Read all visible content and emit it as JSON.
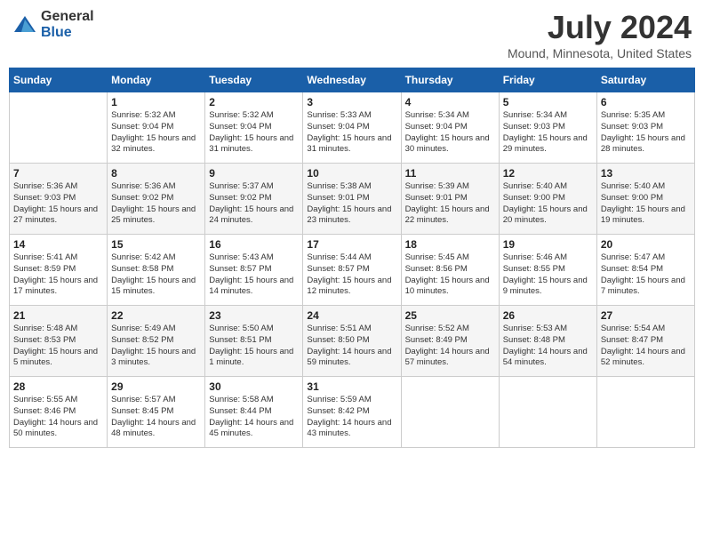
{
  "header": {
    "logo_general": "General",
    "logo_blue": "Blue",
    "month_title": "July 2024",
    "location": "Mound, Minnesota, United States"
  },
  "weekdays": [
    "Sunday",
    "Monday",
    "Tuesday",
    "Wednesday",
    "Thursday",
    "Friday",
    "Saturday"
  ],
  "weeks": [
    [
      {
        "day": "",
        "info": ""
      },
      {
        "day": "1",
        "info": "Sunrise: 5:32 AM\nSunset: 9:04 PM\nDaylight: 15 hours\nand 32 minutes."
      },
      {
        "day": "2",
        "info": "Sunrise: 5:32 AM\nSunset: 9:04 PM\nDaylight: 15 hours\nand 31 minutes."
      },
      {
        "day": "3",
        "info": "Sunrise: 5:33 AM\nSunset: 9:04 PM\nDaylight: 15 hours\nand 31 minutes."
      },
      {
        "day": "4",
        "info": "Sunrise: 5:34 AM\nSunset: 9:04 PM\nDaylight: 15 hours\nand 30 minutes."
      },
      {
        "day": "5",
        "info": "Sunrise: 5:34 AM\nSunset: 9:03 PM\nDaylight: 15 hours\nand 29 minutes."
      },
      {
        "day": "6",
        "info": "Sunrise: 5:35 AM\nSunset: 9:03 PM\nDaylight: 15 hours\nand 28 minutes."
      }
    ],
    [
      {
        "day": "7",
        "info": "Sunrise: 5:36 AM\nSunset: 9:03 PM\nDaylight: 15 hours\nand 27 minutes."
      },
      {
        "day": "8",
        "info": "Sunrise: 5:36 AM\nSunset: 9:02 PM\nDaylight: 15 hours\nand 25 minutes."
      },
      {
        "day": "9",
        "info": "Sunrise: 5:37 AM\nSunset: 9:02 PM\nDaylight: 15 hours\nand 24 minutes."
      },
      {
        "day": "10",
        "info": "Sunrise: 5:38 AM\nSunset: 9:01 PM\nDaylight: 15 hours\nand 23 minutes."
      },
      {
        "day": "11",
        "info": "Sunrise: 5:39 AM\nSunset: 9:01 PM\nDaylight: 15 hours\nand 22 minutes."
      },
      {
        "day": "12",
        "info": "Sunrise: 5:40 AM\nSunset: 9:00 PM\nDaylight: 15 hours\nand 20 minutes."
      },
      {
        "day": "13",
        "info": "Sunrise: 5:40 AM\nSunset: 9:00 PM\nDaylight: 15 hours\nand 19 minutes."
      }
    ],
    [
      {
        "day": "14",
        "info": "Sunrise: 5:41 AM\nSunset: 8:59 PM\nDaylight: 15 hours\nand 17 minutes."
      },
      {
        "day": "15",
        "info": "Sunrise: 5:42 AM\nSunset: 8:58 PM\nDaylight: 15 hours\nand 15 minutes."
      },
      {
        "day": "16",
        "info": "Sunrise: 5:43 AM\nSunset: 8:57 PM\nDaylight: 15 hours\nand 14 minutes."
      },
      {
        "day": "17",
        "info": "Sunrise: 5:44 AM\nSunset: 8:57 PM\nDaylight: 15 hours\nand 12 minutes."
      },
      {
        "day": "18",
        "info": "Sunrise: 5:45 AM\nSunset: 8:56 PM\nDaylight: 15 hours\nand 10 minutes."
      },
      {
        "day": "19",
        "info": "Sunrise: 5:46 AM\nSunset: 8:55 PM\nDaylight: 15 hours\nand 9 minutes."
      },
      {
        "day": "20",
        "info": "Sunrise: 5:47 AM\nSunset: 8:54 PM\nDaylight: 15 hours\nand 7 minutes."
      }
    ],
    [
      {
        "day": "21",
        "info": "Sunrise: 5:48 AM\nSunset: 8:53 PM\nDaylight: 15 hours\nand 5 minutes."
      },
      {
        "day": "22",
        "info": "Sunrise: 5:49 AM\nSunset: 8:52 PM\nDaylight: 15 hours\nand 3 minutes."
      },
      {
        "day": "23",
        "info": "Sunrise: 5:50 AM\nSunset: 8:51 PM\nDaylight: 15 hours\nand 1 minute."
      },
      {
        "day": "24",
        "info": "Sunrise: 5:51 AM\nSunset: 8:50 PM\nDaylight: 14 hours\nand 59 minutes."
      },
      {
        "day": "25",
        "info": "Sunrise: 5:52 AM\nSunset: 8:49 PM\nDaylight: 14 hours\nand 57 minutes."
      },
      {
        "day": "26",
        "info": "Sunrise: 5:53 AM\nSunset: 8:48 PM\nDaylight: 14 hours\nand 54 minutes."
      },
      {
        "day": "27",
        "info": "Sunrise: 5:54 AM\nSunset: 8:47 PM\nDaylight: 14 hours\nand 52 minutes."
      }
    ],
    [
      {
        "day": "28",
        "info": "Sunrise: 5:55 AM\nSunset: 8:46 PM\nDaylight: 14 hours\nand 50 minutes."
      },
      {
        "day": "29",
        "info": "Sunrise: 5:57 AM\nSunset: 8:45 PM\nDaylight: 14 hours\nand 48 minutes."
      },
      {
        "day": "30",
        "info": "Sunrise: 5:58 AM\nSunset: 8:44 PM\nDaylight: 14 hours\nand 45 minutes."
      },
      {
        "day": "31",
        "info": "Sunrise: 5:59 AM\nSunset: 8:42 PM\nDaylight: 14 hours\nand 43 minutes."
      },
      {
        "day": "",
        "info": ""
      },
      {
        "day": "",
        "info": ""
      },
      {
        "day": "",
        "info": ""
      }
    ]
  ]
}
